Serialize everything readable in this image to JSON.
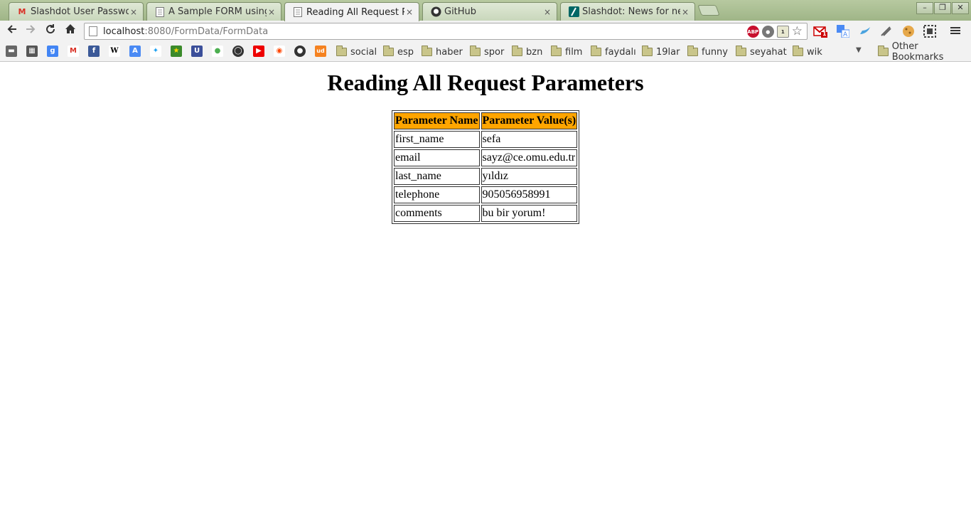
{
  "browser": {
    "tabs": [
      {
        "title": "Slashdot User Password",
        "favicon": "gmail-icon",
        "active": false
      },
      {
        "title": "A Sample FORM using P",
        "favicon": "document-icon",
        "active": false
      },
      {
        "title": "Reading All Request Par",
        "favicon": "document-icon",
        "active": true
      },
      {
        "title": "GitHub",
        "favicon": "github-icon",
        "active": false
      },
      {
        "title": "Slashdot: News for nerd",
        "favicon": "slashdot-icon",
        "active": false
      }
    ],
    "tab_close": "×",
    "window_controls": {
      "minimize": "–",
      "maximize": "❐",
      "close": "✕"
    },
    "url_host": "localhost",
    "url_rest": ":8080/FormData/FormData",
    "gmail_badge": "1",
    "bookmarks_folders": [
      "social",
      "esp",
      "haber",
      "spor",
      "bzn",
      "film",
      "faydalı",
      "19lar",
      "funny",
      "seyahat",
      "wik"
    ],
    "other_bookmarks": "Other Bookmarks",
    "colors": {
      "tabstrip": "#9fb587",
      "toolbar": "#f2f2f2",
      "table_header": "#ffa500"
    }
  },
  "page": {
    "heading": "Reading All Request Parameters",
    "table": {
      "headers": [
        "Parameter Name",
        "Parameter Value(s)"
      ],
      "rows": [
        [
          "first_name",
          "sefa"
        ],
        [
          "email",
          "sayz@ce.omu.edu.tr"
        ],
        [
          "last_name",
          "yıldız"
        ],
        [
          "telephone",
          "905056958991"
        ],
        [
          "comments",
          "bu bir yorum!"
        ]
      ]
    }
  }
}
